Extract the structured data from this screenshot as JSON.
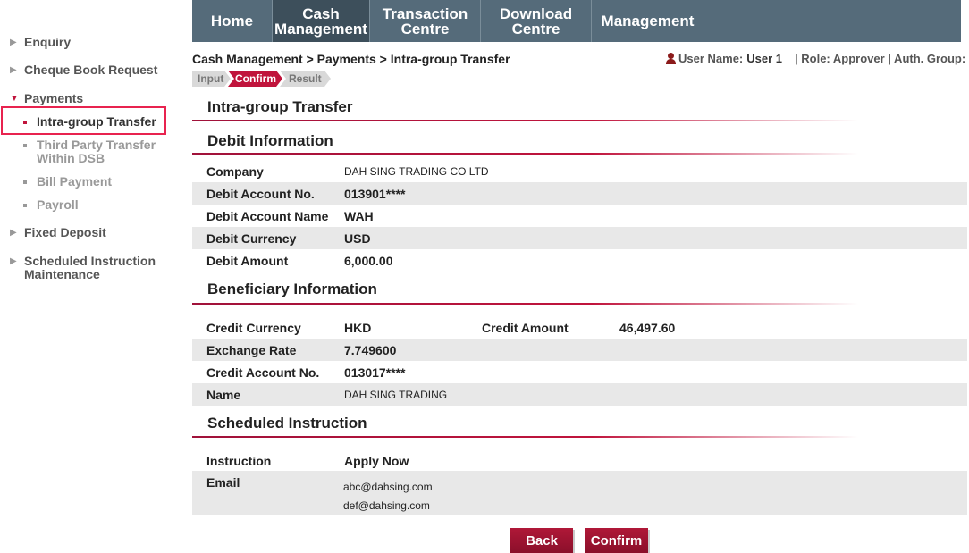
{
  "sidebar": {
    "items": [
      {
        "label": "Enquiry"
      },
      {
        "label": "Cheque Book Request"
      },
      {
        "label": "Payments"
      },
      {
        "label": "Fixed Deposit"
      },
      {
        "label": "Scheduled Instruction Maintenance"
      }
    ],
    "payments_sub": [
      {
        "label": "Intra-group Transfer"
      },
      {
        "label": "Third Party Transfer Within DSB"
      },
      {
        "label": "Bill Payment"
      },
      {
        "label": "Payroll"
      }
    ]
  },
  "topnav": {
    "tabs": [
      {
        "label": "Home"
      },
      {
        "label": "Cash\nManagement"
      },
      {
        "label": "Transaction\nCentre"
      },
      {
        "label": "Download\nCentre"
      },
      {
        "label": "Management"
      }
    ]
  },
  "breadcrumb": "Cash Management > Payments > Intra-group Transfer",
  "user": {
    "name_label": "User Name:",
    "name": "User 1",
    "role": "| Role: Approver | Auth. Group: B"
  },
  "steps": [
    "Input",
    "Confirm",
    "Result"
  ],
  "page_title": "Intra-group Transfer",
  "debit": {
    "title": "Debit Information",
    "rows": [
      {
        "label": "Company",
        "value": "DAH SING TRADING CO LTD"
      },
      {
        "label": "Debit Account No.",
        "value": "013901****"
      },
      {
        "label": "Debit Account Name",
        "value": "WAH"
      },
      {
        "label": "Debit Currency",
        "value": "USD"
      },
      {
        "label": "Debit Amount",
        "value": "6,000.00"
      }
    ]
  },
  "beneficiary": {
    "title": "Beneficiary Information",
    "credit_currency_label": "Credit Currency",
    "credit_currency": "HKD",
    "credit_amount_label": "Credit Amount",
    "credit_amount": "46,497.60",
    "rows": [
      {
        "label": "Exchange Rate",
        "value": "7.749600"
      },
      {
        "label": "Credit Account No.",
        "value": "013017****"
      },
      {
        "label": "Name",
        "value": "DAH SING TRADING"
      }
    ]
  },
  "scheduled": {
    "title": "Scheduled Instruction",
    "instruction_label": "Instruction",
    "instruction": "Apply Now",
    "email_label": "Email",
    "emails": [
      "abc@dahsing.com",
      "def@dahsing.com"
    ]
  },
  "buttons": {
    "back": "Back",
    "confirm": "Confirm"
  },
  "colors": {
    "accent": "#c0143c",
    "nav_bg": "#556b7a",
    "nav_active": "#3d4f5b",
    "row_shade": "#e8e8e8"
  }
}
